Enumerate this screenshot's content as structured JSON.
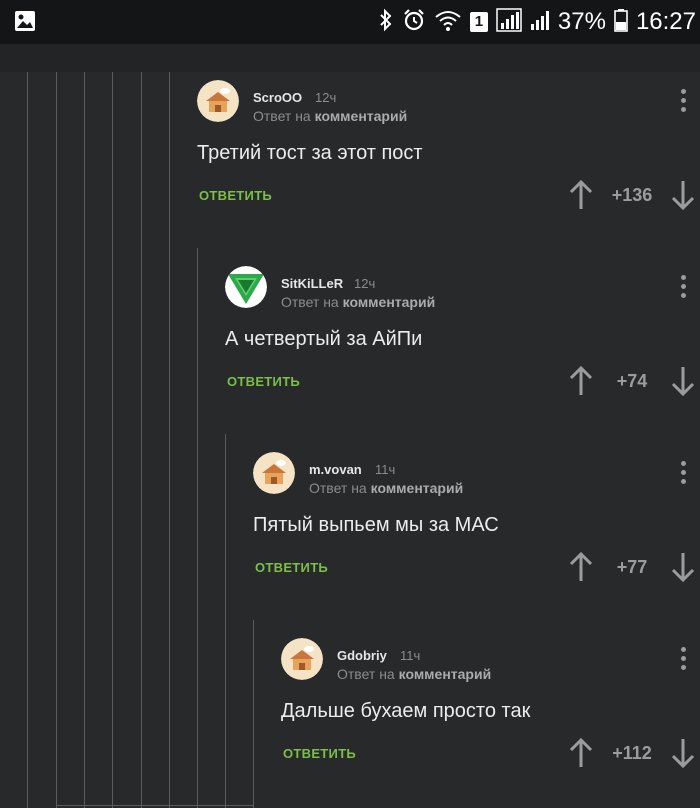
{
  "status_bar": {
    "battery": "37%",
    "time": "16:27",
    "sim_badge": "1",
    "icons": [
      "gallery-icon",
      "bluetooth-icon",
      "alarm-icon",
      "wifi-icon",
      "signal-icon",
      "battery-icon"
    ]
  },
  "colors": {
    "background": "#27292b",
    "reply_action": "#7bbf49",
    "text": "#ececec",
    "muted": "#8a8c8e"
  },
  "comments": [
    {
      "username": "ScroOO",
      "time": "12ч",
      "reply_prefix": "Ответ на",
      "reply_link": "комментарий",
      "text": "Третий тост за этот пост",
      "reply_label": "ОТВЕТИТЬ",
      "score": "+136",
      "avatar": "house-avatar"
    },
    {
      "username": "SitKiLLeR",
      "time": "12ч",
      "reply_prefix": "Ответ на",
      "reply_link": "комментарий",
      "text": "А четвертый за АйПи",
      "reply_label": "ОТВЕТИТЬ",
      "score": "+74",
      "avatar": "green-triangle-avatar"
    },
    {
      "username": "m.vovan",
      "time": "11ч",
      "reply_prefix": "Ответ на",
      "reply_link": "комментарий",
      "text": "Пятый выпьем мы за МАС",
      "reply_label": "ОТВЕТИТЬ",
      "score": "+77",
      "avatar": "house-avatar"
    },
    {
      "username": "Gdobriy",
      "time": "11ч",
      "reply_prefix": "Ответ на",
      "reply_link": "комментарий",
      "text": "Дальше бухаем просто так",
      "reply_label": "ОТВЕТИТЬ",
      "score": "+112",
      "avatar": "house-avatar"
    }
  ]
}
